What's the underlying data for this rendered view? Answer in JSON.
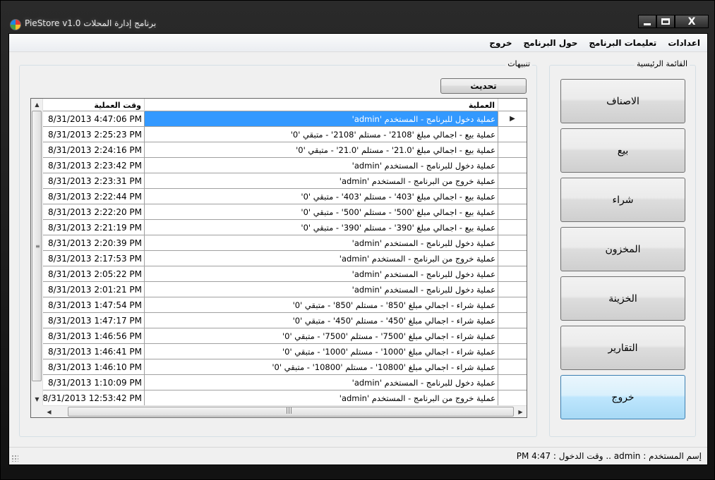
{
  "window": {
    "title": "PieStore v1.0 برنامج إدارة المحلات",
    "min_label": "",
    "max_label": "",
    "close_label": "X"
  },
  "menu": {
    "items": [
      {
        "label": "اعدادات"
      },
      {
        "label": "تعليمات البرنامج"
      },
      {
        "label": "حول البرنامج"
      },
      {
        "label": "خروج"
      }
    ]
  },
  "main_menu": {
    "title": "القائمة الرئيسية",
    "buttons": [
      {
        "label": "الاصناف"
      },
      {
        "label": "بيع"
      },
      {
        "label": "شراء"
      },
      {
        "label": "المخزون"
      },
      {
        "label": "الخزينة"
      },
      {
        "label": "التقارير"
      },
      {
        "label": "خروج"
      }
    ],
    "active_index": 6
  },
  "alerts": {
    "title": "تنبيهات",
    "refresh_label": "تحديث",
    "columns": {
      "time": "وقت العملية",
      "operation": "العملية"
    },
    "selected_marker": "▶",
    "rows": [
      {
        "time": "8/31/2013 4:47:06 PM",
        "operation": "عملية دخول للبرنامج - المستخدم 'admin'"
      },
      {
        "time": "8/31/2013 2:25:23 PM",
        "operation": "عملية بيع - اجمالي مبلغ '2108' - مستلم '2108' - متبقي '0'"
      },
      {
        "time": "8/31/2013 2:24:16 PM",
        "operation": "عملية بيع - اجمالي مبلغ '21.0' - مستلم '21.0' - متبقي '0'"
      },
      {
        "time": "8/31/2013 2:23:42 PM",
        "operation": "عملية دخول للبرنامج - المستخدم 'admin'"
      },
      {
        "time": "8/31/2013 2:23:31 PM",
        "operation": "عملية خروج من البرنامج - المستخدم 'admin'"
      },
      {
        "time": "8/31/2013 2:22:44 PM",
        "operation": "عملية بيع - اجمالي مبلغ '403' - مستلم '403' - متبقي '0'"
      },
      {
        "time": "8/31/2013 2:22:20 PM",
        "operation": "عملية بيع - اجمالي مبلغ '500' - مستلم '500' - متبقي '0'"
      },
      {
        "time": "8/31/2013 2:21:19 PM",
        "operation": "عملية بيع - اجمالي مبلغ '390' - مستلم '390' - متبقي '0'"
      },
      {
        "time": "8/31/2013 2:20:39 PM",
        "operation": "عملية دخول للبرنامج - المستخدم 'admin'"
      },
      {
        "time": "8/31/2013 2:17:53 PM",
        "operation": "عملية خروج من البرنامج - المستخدم 'admin'"
      },
      {
        "time": "8/31/2013 2:05:22 PM",
        "operation": "عملية دخول للبرنامج - المستخدم 'admin'"
      },
      {
        "time": "8/31/2013 2:01:21 PM",
        "operation": "عملية دخول للبرنامج - المستخدم 'admin'"
      },
      {
        "time": "8/31/2013 1:47:54 PM",
        "operation": "عملية شراء - اجمالي مبلغ '850' - مستلم '850' - متبقي '0'"
      },
      {
        "time": "8/31/2013 1:47:17 PM",
        "operation": "عملية شراء - اجمالي مبلغ '450' - مستلم '450' - متبقي '0'"
      },
      {
        "time": "8/31/2013 1:46:56 PM",
        "operation": "عملية شراء - اجمالي مبلغ '7500' - مستلم '7500' - متبقي '0'"
      },
      {
        "time": "8/31/2013 1:46:41 PM",
        "operation": "عملية شراء - اجمالي مبلغ '1000' - مستلم '1000' - متبقي '0'"
      },
      {
        "time": "8/31/2013 1:46:10 PM",
        "operation": "عملية شراء - اجمالي مبلغ '10800' - مستلم '10800' - متبقي '0'"
      },
      {
        "time": "8/31/2013 1:10:09 PM",
        "operation": "عملية دخول للبرنامج - المستخدم 'admin'"
      },
      {
        "time": "8/31/2013 12:53:42 PM",
        "operation": "عملية خروج من البرنامج - المستخدم 'admin'"
      }
    ]
  },
  "status": {
    "text": "إسم المستخدم : admin .. وقت الدخول : 4:47 PM"
  },
  "colors": {
    "selection": "#3399ff",
    "active_button": "#bee6fd"
  }
}
